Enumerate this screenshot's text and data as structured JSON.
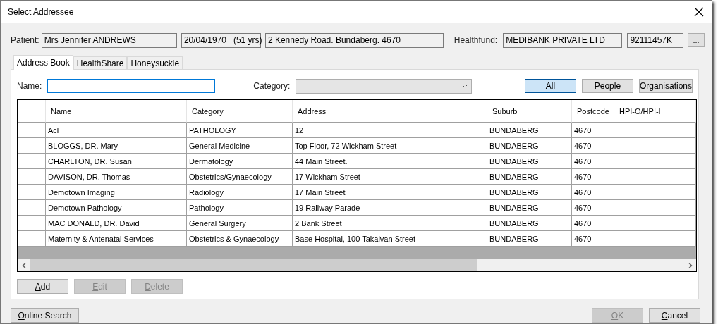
{
  "window": {
    "title": "Select Addressee"
  },
  "patient": {
    "label": "Patient:",
    "name": "Mrs Jennifer ANDREWS",
    "dob": "20/04/1970   (51 yrs)",
    "address": "2 Kennedy Road. Bundaberg. 4670"
  },
  "healthfund": {
    "label": "Healthfund:",
    "name": "MEDIBANK PRIVATE LTD",
    "number": "92111457K",
    "browse": "..."
  },
  "tabs": [
    {
      "label": "Address Book",
      "selected": true
    },
    {
      "label": "HealthShare",
      "selected": false
    },
    {
      "label": "Honeysuckle",
      "selected": false
    }
  ],
  "name_field": {
    "label": "Name:",
    "focused": true
  },
  "category_field": {
    "label": "Category:",
    "disabled": true
  },
  "filters": [
    {
      "label": "All",
      "selected": true
    },
    {
      "label": "People",
      "selected": false
    },
    {
      "label": "Organisations",
      "selected": false
    }
  ],
  "table": {
    "columns": [
      "Name",
      "Category",
      "Address",
      "Suburb",
      "Postcode",
      "HPI-O/HPI-I"
    ],
    "rows": [
      [
        "Acl",
        "PATHOLOGY",
        "12",
        "BUNDABERG",
        "4670",
        ""
      ],
      [
        "BLOGGS, DR. Mary",
        "General Medicine",
        "Top Floor, 72 Wickham Street",
        "BUNDABERG",
        "4670",
        ""
      ],
      [
        "CHARLTON, DR. Susan",
        "Dermatology",
        "44 Main Street.",
        "BUNDABERG",
        "4670",
        ""
      ],
      [
        "DAVISON, DR. Thomas",
        "Obstetrics/Gynaecology",
        "17 Wickham Street",
        "BUNDABERG",
        "4670",
        ""
      ],
      [
        "Demotown Imaging",
        "Radiology",
        "17 Main Street",
        "BUNDABERG",
        "4670",
        ""
      ],
      [
        "Demotown Pathology",
        "Pathology",
        "19 Railway Parade",
        "BUNDABERG",
        "4670",
        ""
      ],
      [
        "MAC DONALD, DR. David",
        "General Surgery",
        "2 Bank Street",
        "BUNDABERG",
        "4670",
        ""
      ],
      [
        "Maternity & Antenatal Services",
        "Obstetrics & Gynaecology",
        "Base Hospital, 100 Takalvan Street",
        "BUNDABERG",
        "4670",
        ""
      ]
    ]
  },
  "row_buttons": [
    {
      "label": "Add",
      "disabled": false
    },
    {
      "label": "Edit",
      "disabled": true
    },
    {
      "label": "Delete",
      "disabled": true
    }
  ],
  "online_search": {
    "label": "Online Search"
  },
  "dialog_buttons": [
    {
      "label": "OK",
      "disabled": true
    },
    {
      "label": "Cancel",
      "disabled": false
    }
  ]
}
